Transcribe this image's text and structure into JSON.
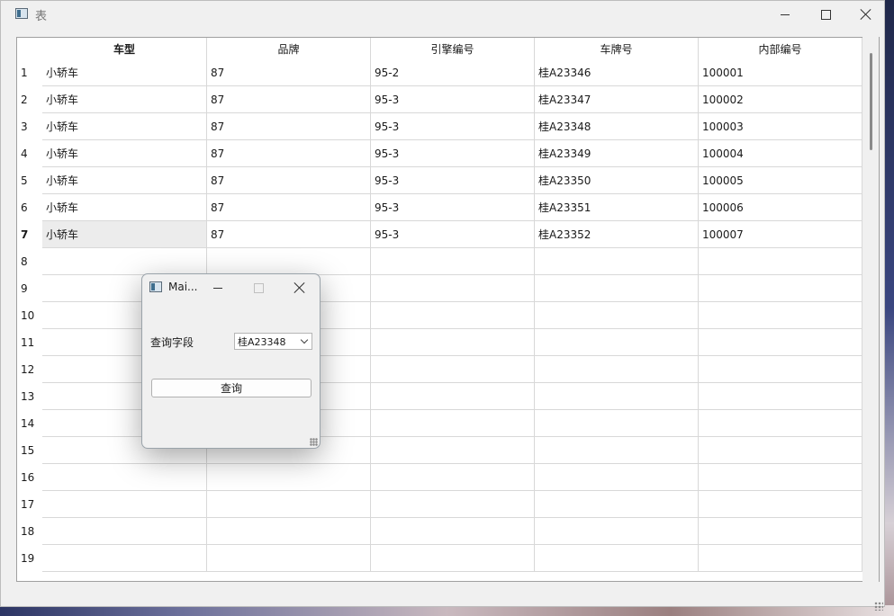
{
  "window": {
    "title": "表",
    "icon": "app-window-icon"
  },
  "table": {
    "columns": [
      "车型",
      "品牌",
      "引擎编号",
      "车牌号",
      "内部编号"
    ],
    "row_numbers": [
      "1",
      "2",
      "3",
      "4",
      "5",
      "6",
      "7",
      "8",
      "9",
      "10",
      "11",
      "12",
      "13",
      "14",
      "15",
      "16",
      "17",
      "18",
      "19"
    ],
    "rows": [
      [
        "小轿车",
        "87",
        "95-2",
        "桂A23346",
        "100001"
      ],
      [
        "小轿车",
        "87",
        "95-3",
        "桂A23347",
        "100002"
      ],
      [
        "小轿车",
        "87",
        "95-3",
        "桂A23348",
        "100003"
      ],
      [
        "小轿车",
        "87",
        "95-3",
        "桂A23349",
        "100004"
      ],
      [
        "小轿车",
        "87",
        "95-3",
        "桂A23350",
        "100005"
      ],
      [
        "小轿车",
        "87",
        "95-3",
        "桂A23351",
        "100006"
      ],
      [
        "小轿车",
        "87",
        "95-3",
        "桂A23352",
        "100007"
      ]
    ],
    "selected_row": 7,
    "selected_col": 1
  },
  "dialog": {
    "title": "Mai...",
    "field_label": "查询字段",
    "select_value": "桂A23348",
    "query_button": "查询"
  }
}
